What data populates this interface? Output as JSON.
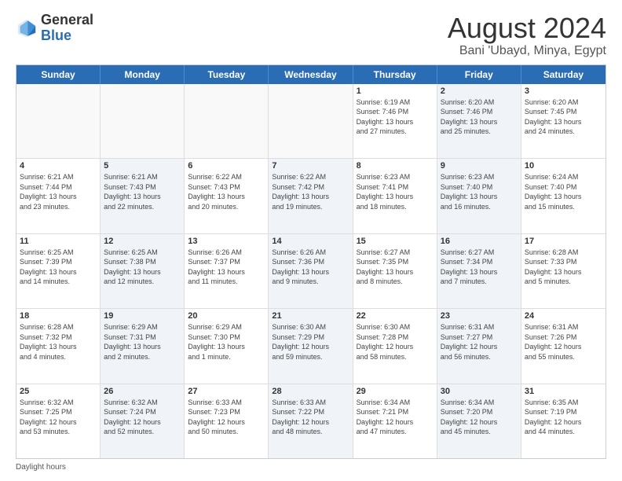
{
  "logo": {
    "general": "General",
    "blue": "Blue"
  },
  "title": "August 2024",
  "subtitle": "Bani 'Ubayd, Minya, Egypt",
  "days_of_week": [
    "Sunday",
    "Monday",
    "Tuesday",
    "Wednesday",
    "Thursday",
    "Friday",
    "Saturday"
  ],
  "footer": {
    "daylight_label": "Daylight hours"
  },
  "weeks": [
    [
      {
        "day": "",
        "info": "",
        "shaded": false
      },
      {
        "day": "",
        "info": "",
        "shaded": false
      },
      {
        "day": "",
        "info": "",
        "shaded": false
      },
      {
        "day": "",
        "info": "",
        "shaded": false
      },
      {
        "day": "1",
        "info": "Sunrise: 6:19 AM\nSunset: 7:46 PM\nDaylight: 13 hours\nand 27 minutes.",
        "shaded": false
      },
      {
        "day": "2",
        "info": "Sunrise: 6:20 AM\nSunset: 7:46 PM\nDaylight: 13 hours\nand 25 minutes.",
        "shaded": true
      },
      {
        "day": "3",
        "info": "Sunrise: 6:20 AM\nSunset: 7:45 PM\nDaylight: 13 hours\nand 24 minutes.",
        "shaded": false
      }
    ],
    [
      {
        "day": "4",
        "info": "Sunrise: 6:21 AM\nSunset: 7:44 PM\nDaylight: 13 hours\nand 23 minutes.",
        "shaded": false
      },
      {
        "day": "5",
        "info": "Sunrise: 6:21 AM\nSunset: 7:43 PM\nDaylight: 13 hours\nand 22 minutes.",
        "shaded": true
      },
      {
        "day": "6",
        "info": "Sunrise: 6:22 AM\nSunset: 7:43 PM\nDaylight: 13 hours\nand 20 minutes.",
        "shaded": false
      },
      {
        "day": "7",
        "info": "Sunrise: 6:22 AM\nSunset: 7:42 PM\nDaylight: 13 hours\nand 19 minutes.",
        "shaded": true
      },
      {
        "day": "8",
        "info": "Sunrise: 6:23 AM\nSunset: 7:41 PM\nDaylight: 13 hours\nand 18 minutes.",
        "shaded": false
      },
      {
        "day": "9",
        "info": "Sunrise: 6:23 AM\nSunset: 7:40 PM\nDaylight: 13 hours\nand 16 minutes.",
        "shaded": true
      },
      {
        "day": "10",
        "info": "Sunrise: 6:24 AM\nSunset: 7:40 PM\nDaylight: 13 hours\nand 15 minutes.",
        "shaded": false
      }
    ],
    [
      {
        "day": "11",
        "info": "Sunrise: 6:25 AM\nSunset: 7:39 PM\nDaylight: 13 hours\nand 14 minutes.",
        "shaded": false
      },
      {
        "day": "12",
        "info": "Sunrise: 6:25 AM\nSunset: 7:38 PM\nDaylight: 13 hours\nand 12 minutes.",
        "shaded": true
      },
      {
        "day": "13",
        "info": "Sunrise: 6:26 AM\nSunset: 7:37 PM\nDaylight: 13 hours\nand 11 minutes.",
        "shaded": false
      },
      {
        "day": "14",
        "info": "Sunrise: 6:26 AM\nSunset: 7:36 PM\nDaylight: 13 hours\nand 9 minutes.",
        "shaded": true
      },
      {
        "day": "15",
        "info": "Sunrise: 6:27 AM\nSunset: 7:35 PM\nDaylight: 13 hours\nand 8 minutes.",
        "shaded": false
      },
      {
        "day": "16",
        "info": "Sunrise: 6:27 AM\nSunset: 7:34 PM\nDaylight: 13 hours\nand 7 minutes.",
        "shaded": true
      },
      {
        "day": "17",
        "info": "Sunrise: 6:28 AM\nSunset: 7:33 PM\nDaylight: 13 hours\nand 5 minutes.",
        "shaded": false
      }
    ],
    [
      {
        "day": "18",
        "info": "Sunrise: 6:28 AM\nSunset: 7:32 PM\nDaylight: 13 hours\nand 4 minutes.",
        "shaded": false
      },
      {
        "day": "19",
        "info": "Sunrise: 6:29 AM\nSunset: 7:31 PM\nDaylight: 13 hours\nand 2 minutes.",
        "shaded": true
      },
      {
        "day": "20",
        "info": "Sunrise: 6:29 AM\nSunset: 7:30 PM\nDaylight: 13 hours\nand 1 minute.",
        "shaded": false
      },
      {
        "day": "21",
        "info": "Sunrise: 6:30 AM\nSunset: 7:29 PM\nDaylight: 12 hours\nand 59 minutes.",
        "shaded": true
      },
      {
        "day": "22",
        "info": "Sunrise: 6:30 AM\nSunset: 7:28 PM\nDaylight: 12 hours\nand 58 minutes.",
        "shaded": false
      },
      {
        "day": "23",
        "info": "Sunrise: 6:31 AM\nSunset: 7:27 PM\nDaylight: 12 hours\nand 56 minutes.",
        "shaded": true
      },
      {
        "day": "24",
        "info": "Sunrise: 6:31 AM\nSunset: 7:26 PM\nDaylight: 12 hours\nand 55 minutes.",
        "shaded": false
      }
    ],
    [
      {
        "day": "25",
        "info": "Sunrise: 6:32 AM\nSunset: 7:25 PM\nDaylight: 12 hours\nand 53 minutes.",
        "shaded": false
      },
      {
        "day": "26",
        "info": "Sunrise: 6:32 AM\nSunset: 7:24 PM\nDaylight: 12 hours\nand 52 minutes.",
        "shaded": true
      },
      {
        "day": "27",
        "info": "Sunrise: 6:33 AM\nSunset: 7:23 PM\nDaylight: 12 hours\nand 50 minutes.",
        "shaded": false
      },
      {
        "day": "28",
        "info": "Sunrise: 6:33 AM\nSunset: 7:22 PM\nDaylight: 12 hours\nand 48 minutes.",
        "shaded": true
      },
      {
        "day": "29",
        "info": "Sunrise: 6:34 AM\nSunset: 7:21 PM\nDaylight: 12 hours\nand 47 minutes.",
        "shaded": false
      },
      {
        "day": "30",
        "info": "Sunrise: 6:34 AM\nSunset: 7:20 PM\nDaylight: 12 hours\nand 45 minutes.",
        "shaded": true
      },
      {
        "day": "31",
        "info": "Sunrise: 6:35 AM\nSunset: 7:19 PM\nDaylight: 12 hours\nand 44 minutes.",
        "shaded": false
      }
    ]
  ]
}
